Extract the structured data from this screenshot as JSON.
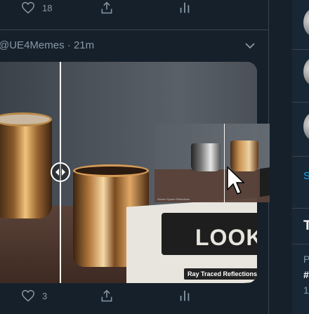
{
  "feed": {
    "top_actions": {
      "like_count": "18"
    },
    "tweet": {
      "handle": "@UE4Memes",
      "separator": "·",
      "time": "21m",
      "media_caption": "Ray Traced Reflections",
      "book_text": "LOOK",
      "preview_left_label": "Screen Space Reflections",
      "preview_right_label": "Ray Traced Reflections"
    },
    "bottom_actions": {
      "like_count": "3"
    }
  },
  "sidebar": {
    "show_more_fragment": "S",
    "trends_fragment": "T",
    "trend_line_1": "P",
    "trend_tag": "#",
    "trend_line_2": "1"
  },
  "colors": {
    "background": "#15202b",
    "border": "#38444d",
    "muted_text": "#8899a6",
    "accent": "#1da1f2"
  },
  "icons": [
    "heart-icon",
    "share-icon",
    "analytics-icon",
    "chevron-down-icon",
    "slider-arrows-icon",
    "cursor-icon"
  ]
}
